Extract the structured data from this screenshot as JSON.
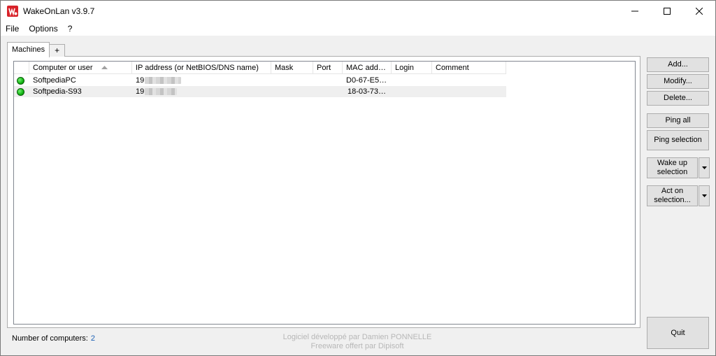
{
  "window": {
    "title": "WakeOnLan v3.9.7"
  },
  "menu": [
    "File",
    "Options",
    "?"
  ],
  "tabs": [
    {
      "label": "Machines"
    },
    {
      "label": "+"
    }
  ],
  "table": {
    "columns": [
      "Computer or user",
      "IP address (or NetBIOS/DNS name)",
      "Mask",
      "Port",
      "MAC add…",
      "Login",
      "Comment"
    ],
    "sorted_column": "Computer or user",
    "sort_direction": "ascending",
    "rows": [
      {
        "status": "online",
        "name": "SoftpediaPC",
        "ip": "19",
        "mask": "",
        "port": "",
        "mac": "D0-67-E5…",
        "login": "",
        "comment": ""
      },
      {
        "status": "online",
        "name": "Softpedia-S93",
        "ip": "19",
        "mask": "",
        "port": "",
        "mac": "18-03-73…",
        "login": "",
        "comment": ""
      }
    ]
  },
  "buttons": {
    "add": "Add...",
    "modify": "Modify...",
    "delete": "Delete...",
    "ping_all": "Ping all",
    "ping_selection": "Ping selection",
    "wake_up_line1": "Wake up",
    "wake_up_line2": "selection",
    "act_on_line1": "Act on",
    "act_on_line2": "selection...",
    "quit": "Quit"
  },
  "footer": {
    "count_label": "Number of computers:",
    "count_value": "2",
    "credit_line1": "Logiciel développé par Damien PONNELLE",
    "credit_line2": "Freeware offert par Dipisoft"
  },
  "colors": {
    "status_online": "#12b312",
    "count_value": "#1a5fb4",
    "app_icon": "#d8232a"
  },
  "icons": {
    "app": "wakeonlan-app-icon",
    "minimize": "minimize-icon",
    "maximize": "maximize-icon",
    "close": "close-icon",
    "dropdown": "chevron-down-icon",
    "sort": "sort-ascending-icon"
  }
}
